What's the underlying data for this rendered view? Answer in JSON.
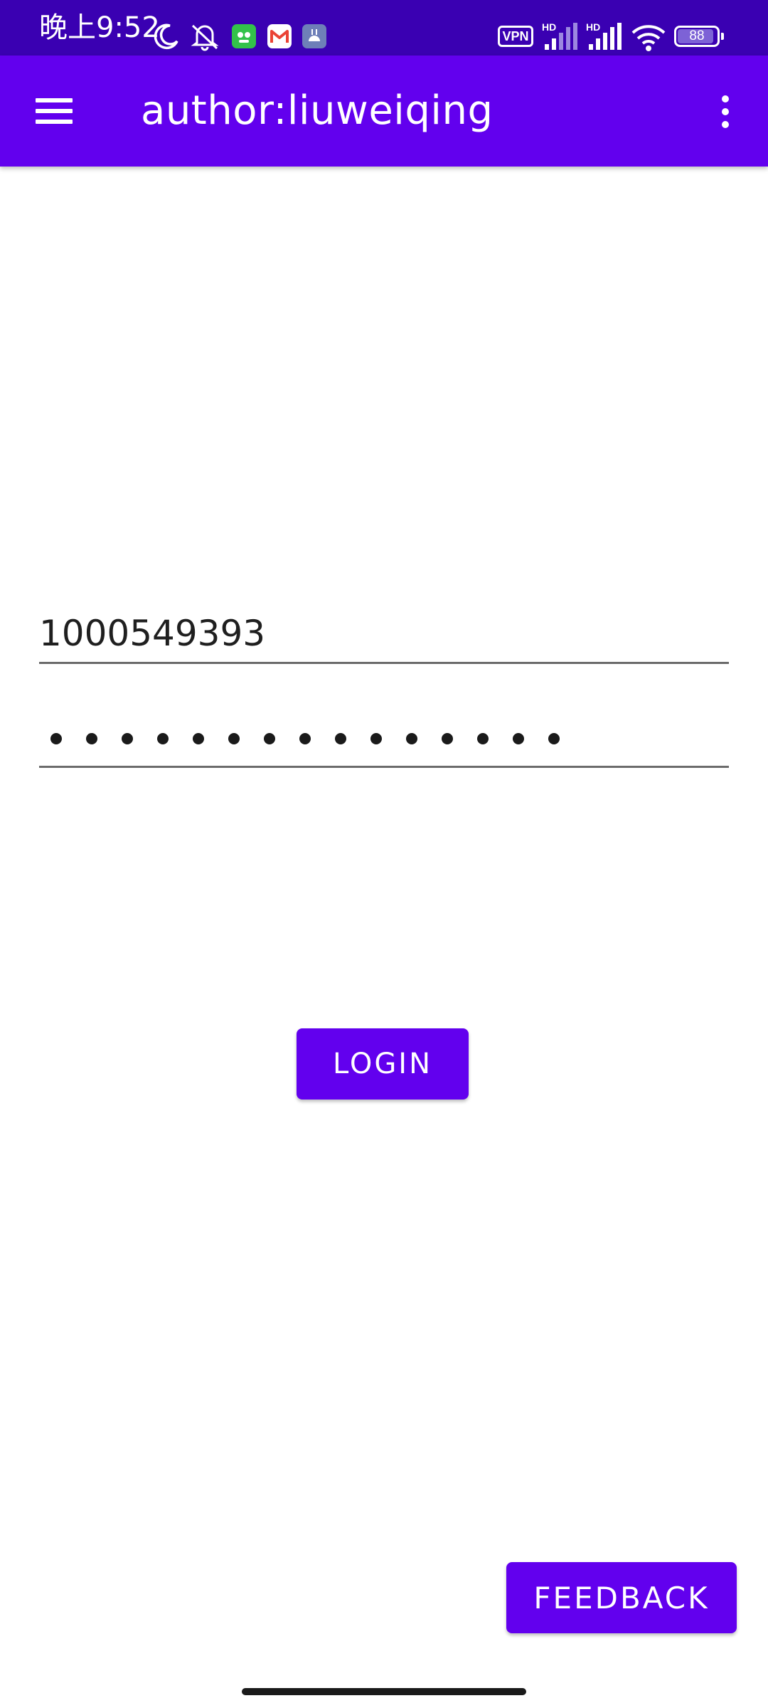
{
  "status_bar": {
    "time": "晚上9:52",
    "vpn_label": "VPN",
    "signal_label_1": "HD",
    "signal_label_2": "HD",
    "battery": "88",
    "icons": [
      "moon-icon",
      "silent-bell-icon",
      "green-app-icon",
      "gmail-icon",
      "android-app-icon",
      "vpn-icon",
      "signal-hd-icon",
      "signal-hd-icon",
      "wifi-icon",
      "battery-icon"
    ]
  },
  "app_bar": {
    "title": "author:liuweiqing",
    "menu_icon": "hamburger-menu-icon",
    "overflow_icon": "more-vert-icon",
    "color": "#6200ee"
  },
  "login_form": {
    "username_value": "1000549393",
    "password_masked": "•••••••••••••••"
  },
  "buttons": {
    "login_label": "LOGIN",
    "feedback_label": "FEEDBACK"
  },
  "colors": {
    "primary": "#6200ee",
    "status_bar": "#3a00b2"
  }
}
